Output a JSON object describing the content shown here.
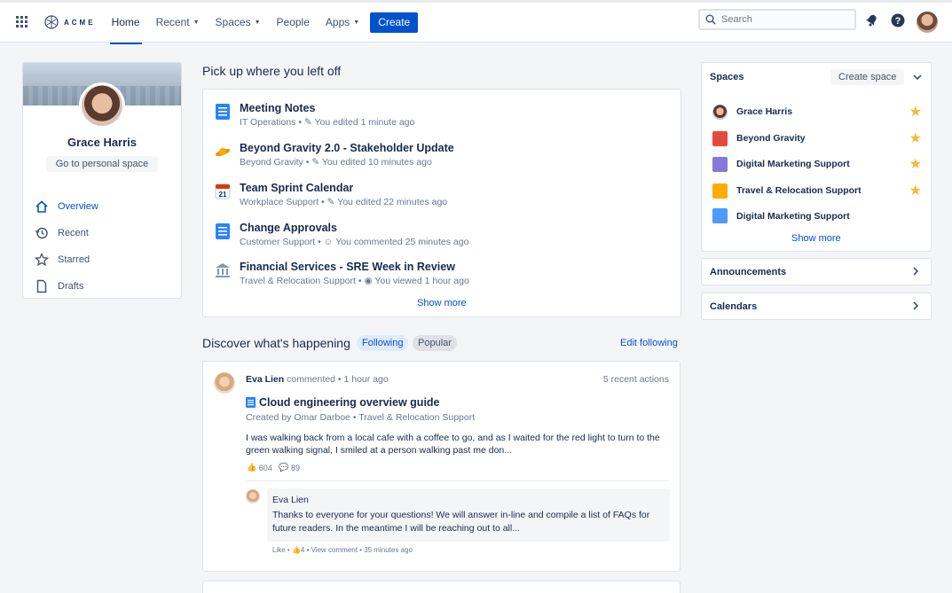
{
  "nav": {
    "logo_text": "ACME",
    "items": [
      {
        "label": "Home"
      },
      {
        "label": "Recent"
      },
      {
        "label": "Spaces"
      },
      {
        "label": "People"
      },
      {
        "label": "Apps"
      }
    ],
    "create_label": "Create",
    "search_placeholder": "Search",
    "accent": "#0052cc"
  },
  "profile": {
    "name": "Grace Harris",
    "personal_space_label": "Go to personal space",
    "menu": [
      {
        "label": "Overview",
        "icon": "home-icon"
      },
      {
        "label": "Recent",
        "icon": "history-icon"
      },
      {
        "label": "Starred",
        "icon": "star-icon"
      },
      {
        "label": "Drafts",
        "icon": "page-icon"
      }
    ]
  },
  "recent": {
    "title": "Pick up where you left off",
    "items": [
      {
        "title": "Meeting Notes",
        "space": "IT Operations",
        "action": "You edited 1 minute ago",
        "icon": "page-icon"
      },
      {
        "title": "Beyond Gravity 2.0 - Stakeholder Update",
        "space": "Beyond Gravity",
        "action": "You edited 10 minutes ago",
        "icon": "planet-icon"
      },
      {
        "title": "Team Sprint Calendar",
        "space": "Workplace Support",
        "action": "You edited 22 minutes ago",
        "icon": "calendar-icon"
      },
      {
        "title": "Change Approvals",
        "space": "Customer Support",
        "action": "You commented 25 minutes ago",
        "icon": "page-icon"
      },
      {
        "title": "Financial Services - SRE Week in Review",
        "space": "Travel & Relocation Support",
        "action": "You viewed 1 hour ago",
        "icon": "bank-icon"
      }
    ],
    "show_more": "Show more"
  },
  "discover": {
    "title": "Discover what's happening",
    "tab_following": "Following",
    "tab_popular": "Popular",
    "edit_following": "Edit following",
    "activity": {
      "user": "Eva Lien",
      "verb": "commented",
      "time": "1 hour ago",
      "recent_actions": "5 recent actions",
      "doc_title": "Cloud engineering overview guide",
      "doc_meta": "Created by Omar Darboe • Travel & Relocation Support",
      "excerpt": "I was walking back from a local cafe with a coffee to go, and as I waited for the red light to turn to the green walking signal, I smiled at a person walking past me don...",
      "likes": "604",
      "comments": "89",
      "comment": {
        "author": "Eva Lien",
        "text": "Thanks to everyone for your questions! We will answer in-line and compile a list of FAQs for future readers. In the meantime I will be reaching out to all...",
        "like_label": "Like",
        "like_count": "4",
        "view_comment": "View comment",
        "time": "35 minutes ago"
      }
    }
  },
  "spaces": {
    "title": "Spaces",
    "create_label": "Create space",
    "items": [
      {
        "name": "Grace Harris",
        "starred": true,
        "color": "#c7a08a"
      },
      {
        "name": "Beyond Gravity",
        "starred": true,
        "color": "#e5493a"
      },
      {
        "name": "Digital Marketing Support",
        "starred": true,
        "color": "#8777d9"
      },
      {
        "name": "Travel & Relocation Support",
        "starred": true,
        "color": "#ffab00"
      },
      {
        "name": "Digital Marketing Support",
        "starred": false,
        "color": "#4c9aff"
      }
    ],
    "show_more": "Show more"
  },
  "announcements": {
    "title": "Announcements"
  },
  "calendars": {
    "title": "Calendars"
  }
}
